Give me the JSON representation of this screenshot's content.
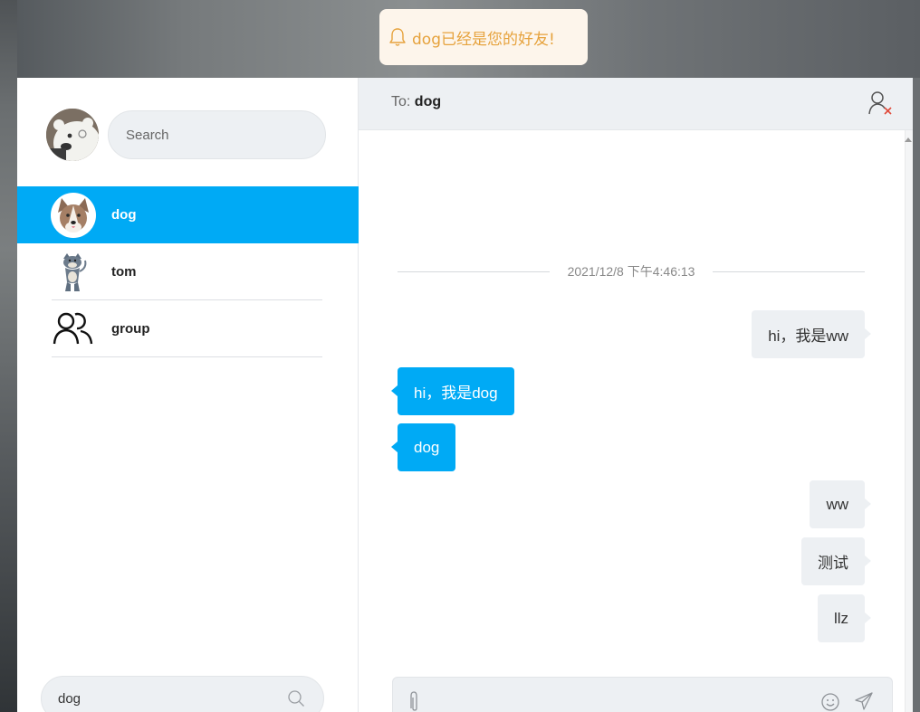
{
  "toast": {
    "message": "dog已经是您的好友!"
  },
  "sidebar": {
    "search_placeholder": "Search",
    "contacts": [
      {
        "name": "dog",
        "active": true
      },
      {
        "name": "tom",
        "active": false
      },
      {
        "name": "group",
        "active": false
      }
    ],
    "bottom_search_value": "dog"
  },
  "chat": {
    "to_label": "To:",
    "to_name": "dog",
    "timestamp": "2021/12/8 下午4:46:13",
    "messages": [
      {
        "text": "hi，我是ww",
        "from": "me"
      },
      {
        "text": "hi，我是dog",
        "from": "dog"
      },
      {
        "text": "dog",
        "from": "dog"
      },
      {
        "text": "ww",
        "from": "me"
      },
      {
        "text": "测试",
        "from": "me"
      },
      {
        "text": "llz",
        "from": "me"
      }
    ]
  },
  "colors": {
    "accent": "#00aaf5",
    "toast_text": "#e6a23c",
    "toast_bg": "#fdf5eb",
    "panel_grey": "#edf0f3"
  }
}
